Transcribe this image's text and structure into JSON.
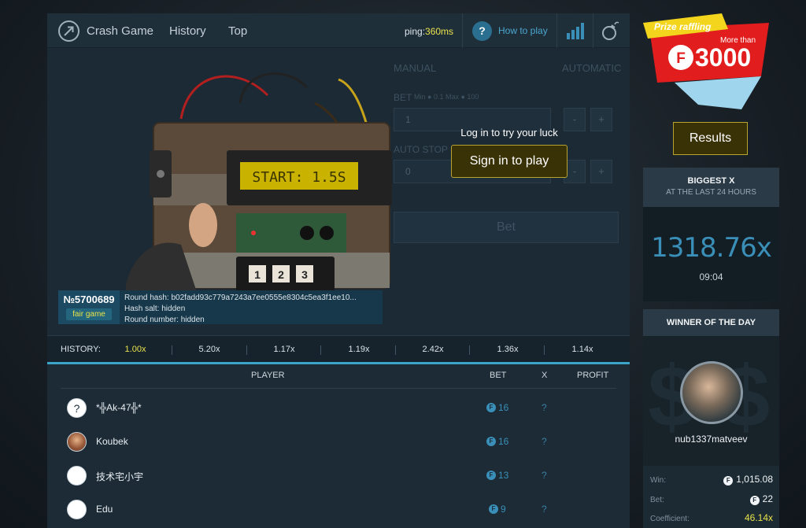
{
  "nav": {
    "items": [
      "Crash Game",
      "History",
      "Top"
    ],
    "ping_label": "ping:",
    "ping_value": "360ms",
    "help_symbol": "?",
    "how_to_play": "How to play"
  },
  "game": {
    "display_text": "START: 1.5S",
    "keypad": [
      "1",
      "2",
      "3"
    ],
    "round_number": "№5700689",
    "fair_game": "fair game",
    "round_hash": "Round hash: b02fadd93c779a7243a7ee0555e8304c5ea3f1ee10...",
    "hash_salt": "Hash salt: hidden",
    "round_number_text": "Round number: hidden"
  },
  "bet_panel": {
    "manual": "MANUAL",
    "automatic": "AUTOMATIC",
    "bet_label": "BET",
    "bet_hint": "Min ● 0.1 Max ● 100",
    "bet_value": "1",
    "auto_stop": "AUTO STOP",
    "auto_stop_value": "0",
    "minus": "-",
    "plus": "+",
    "bet_button": "Bet"
  },
  "login": {
    "prompt": "Log in to try your luck",
    "sign_in": "Sign in to play"
  },
  "history": {
    "label": "HISTORY:",
    "values": [
      "1.00x",
      "5.20x",
      "1.17x",
      "1.19x",
      "2.42x",
      "1.36x",
      "1.14x"
    ]
  },
  "players": {
    "headers": {
      "player": "PLAYER",
      "bet": "BET",
      "x": "X",
      "profit": "PROFIT"
    },
    "coin": "F",
    "rows": [
      {
        "avatar": "?",
        "name": "*╬Ak-47╬*",
        "bet": "16",
        "x": "?"
      },
      {
        "avatar": "",
        "name": "Koubek",
        "bet": "16",
        "x": "?"
      },
      {
        "avatar": "",
        "name": "技术宅小宇",
        "bet": "13",
        "x": "?"
      },
      {
        "avatar": "",
        "name": "Edu",
        "bet": "9",
        "x": "?"
      }
    ]
  },
  "sidebar": {
    "promo_title": "Prize raffling",
    "promo_more_than": "More than",
    "promo_amount": "3000",
    "promo_coin": "F",
    "results": "Results",
    "biggest_title": "BIGGEST X",
    "biggest_sub": "AT THE LAST 24 HOURS",
    "biggest_value": "1318.76x",
    "biggest_time": "09:04",
    "winner_title": "WINNER OF THE DAY",
    "winner_name": "nub1337matveev",
    "win_label": "Win:",
    "win_value": "1,015.08",
    "bet_label": "Bet:",
    "bet_value": "22",
    "coef_label": "Coefficient:",
    "coef_value": "46.14x"
  },
  "colors": {
    "accent_blue": "#3a8fb8",
    "accent_yellow": "#e9e24b",
    "panel": "#1c2b36"
  }
}
